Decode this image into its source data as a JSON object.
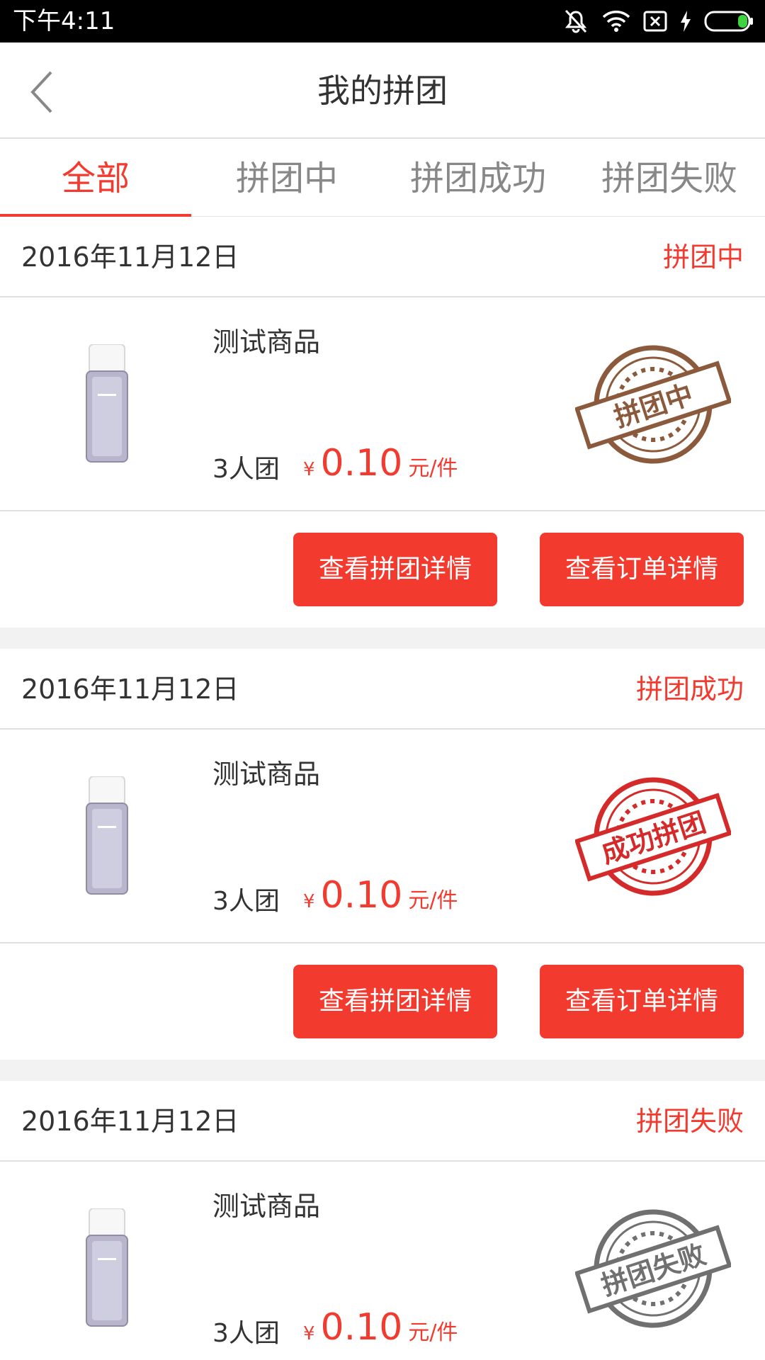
{
  "status_bar": {
    "time": "下午4:11"
  },
  "nav": {
    "title": "我的拼团"
  },
  "tabs": [
    {
      "label": "全部",
      "active": true
    },
    {
      "label": "拼团中",
      "active": false
    },
    {
      "label": "拼团成功",
      "active": false
    },
    {
      "label": "拼团失败",
      "active": false
    }
  ],
  "orders": [
    {
      "date": "2016年11月12日",
      "status": "拼团中",
      "product_name": "测试商品",
      "group_size": "3人团",
      "currency": "¥",
      "price": "0.10",
      "unit": "元/件",
      "stamp_text": "拼团中",
      "stamp_color": "#8b5a3c",
      "btn_group": "查看拼团详情",
      "btn_order": "查看订单详情"
    },
    {
      "date": "2016年11月12日",
      "status": "拼团成功",
      "product_name": "测试商品",
      "group_size": "3人团",
      "currency": "¥",
      "price": "0.10",
      "unit": "元/件",
      "stamp_text": "成功拼团",
      "stamp_color": "#d42a2a",
      "btn_group": "查看拼团详情",
      "btn_order": "查看订单详情"
    },
    {
      "date": "2016年11月12日",
      "status": "拼团失败",
      "product_name": "测试商品",
      "group_size": "3人团",
      "currency": "¥",
      "price": "0.10",
      "unit": "元/件",
      "stamp_text": "拼团失败",
      "stamp_color": "#707070"
    }
  ],
  "colors": {
    "accent": "#f33a2f",
    "divider": "#e0e0e0",
    "tab_inactive": "#888888"
  }
}
